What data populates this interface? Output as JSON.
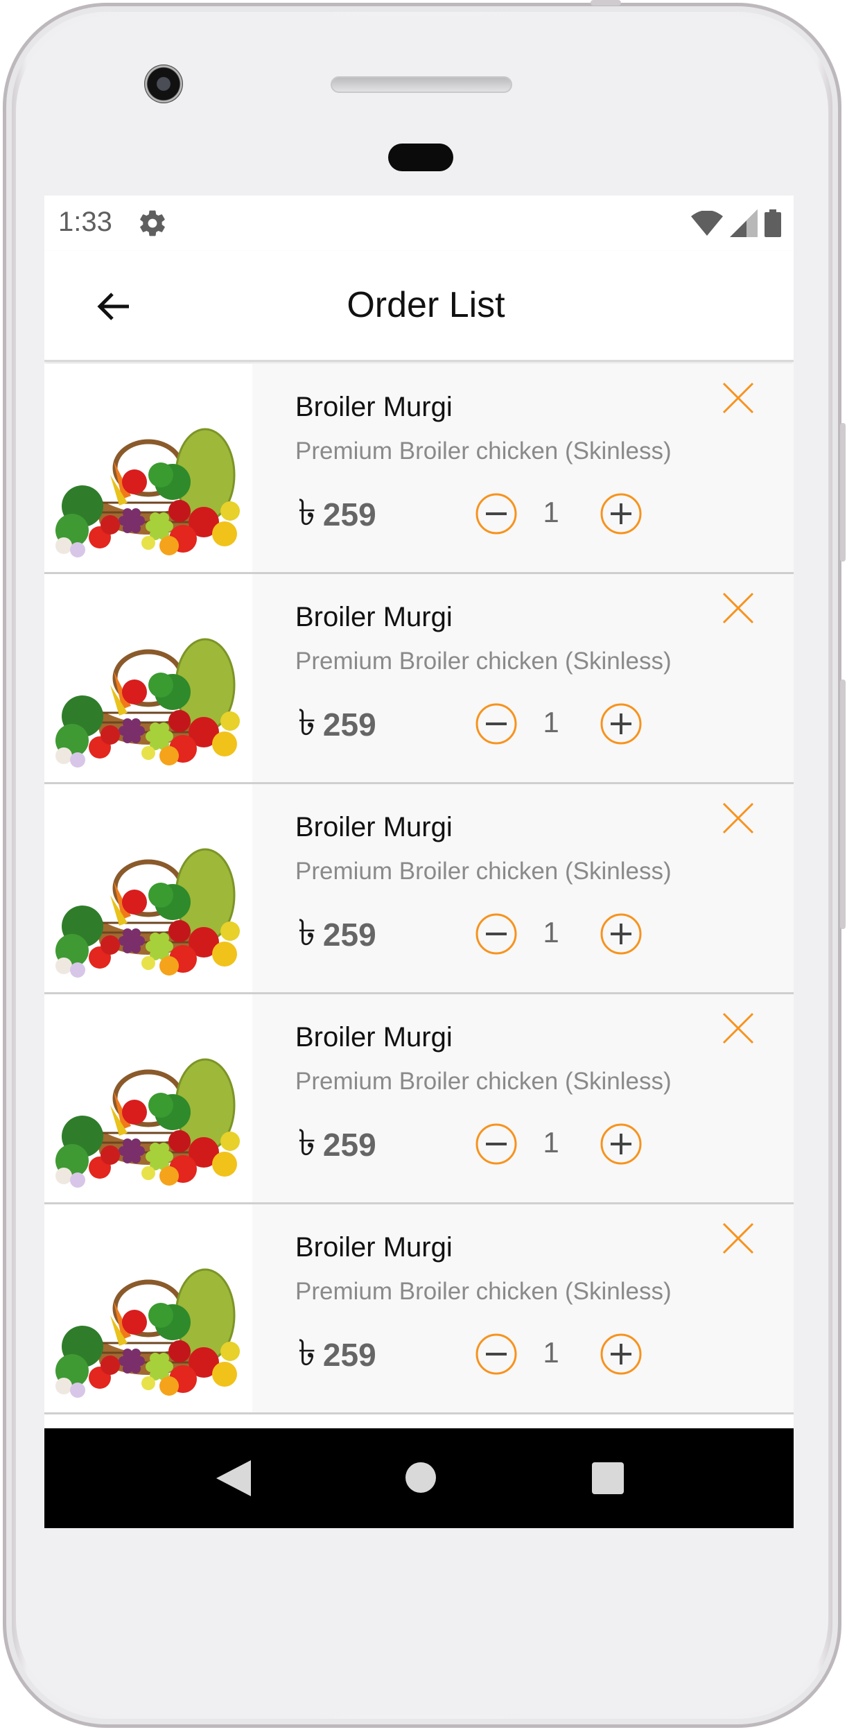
{
  "status_bar": {
    "time": "1:33",
    "icons": [
      "gear-icon",
      "wifi-icon",
      "signal-icon",
      "battery-icon"
    ]
  },
  "app_bar": {
    "title": "Order List",
    "back_icon": "arrow-left-icon"
  },
  "currency_symbol": "৳",
  "accent_color": "#f7931e",
  "orders": [
    {
      "name": "Broiler Murgi",
      "description": "Premium Broiler chicken (Skinless)",
      "price": "259",
      "quantity": "1"
    },
    {
      "name": "Broiler Murgi",
      "description": "Premium Broiler chicken (Skinless)",
      "price": "259",
      "quantity": "1"
    },
    {
      "name": "Broiler Murgi",
      "description": "Premium Broiler chicken (Skinless)",
      "price": "259",
      "quantity": "1"
    },
    {
      "name": "Broiler Murgi",
      "description": "Premium Broiler chicken (Skinless)",
      "price": "259",
      "quantity": "1"
    },
    {
      "name": "Broiler Murgi",
      "description": "Premium Broiler chicken (Skinless)",
      "price": "259",
      "quantity": "1"
    }
  ],
  "nav_bar": {
    "icons": [
      "nav-back-icon",
      "nav-home-icon",
      "nav-recents-icon"
    ]
  }
}
